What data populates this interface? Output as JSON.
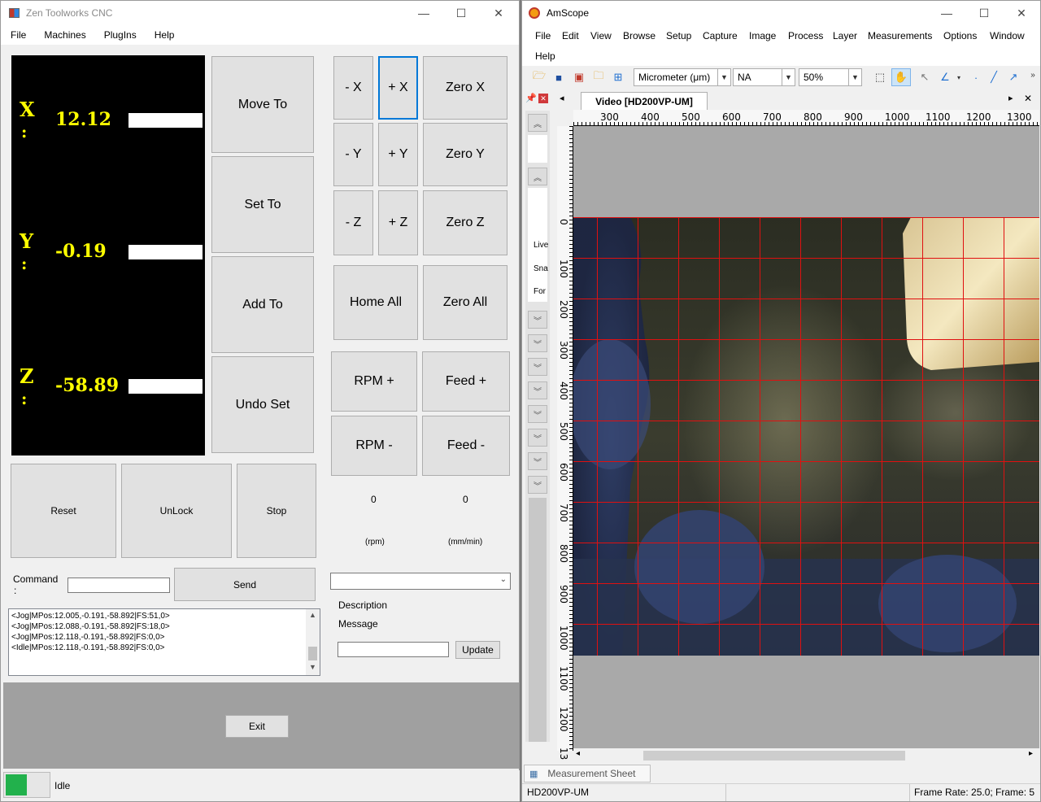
{
  "zen": {
    "title": "Zen Toolworks  CNC",
    "window_controls": {
      "minimize": "—",
      "maximize": "☐",
      "close": "✕"
    },
    "menu": [
      "File",
      "Machines",
      "PlugIns",
      "Help"
    ],
    "dro": {
      "x_label": "X",
      "x_colon": ":",
      "x_value": "12.12",
      "y_label": "Y",
      "y_colon": ":",
      "y_value": "-0.19",
      "z_label": "Z",
      "z_colon": ":",
      "z_value": "-58.89"
    },
    "buttons": {
      "move_to": "Move To",
      "set_to": "Set To",
      "add_to": "Add To",
      "undo_set": "Undo Set",
      "minus_x": "- X",
      "plus_x": "+ X",
      "zero_x": "Zero X",
      "minus_y": "- Y",
      "plus_y": "+ Y",
      "zero_y": "Zero Y",
      "minus_z": "- Z",
      "plus_z": "+ Z",
      "zero_z": "Zero Z",
      "home_all": "Home All",
      "zero_all": "Zero All",
      "rpm_plus": "RPM +",
      "feed_plus": "Feed +",
      "rpm_minus": "RPM -",
      "feed_minus": "Feed -",
      "reset": "Reset",
      "unlock": "UnLock",
      "stop": "Stop",
      "send": "Send",
      "update": "Update",
      "exit": "Exit"
    },
    "rpm_value": "0",
    "rpm_unit": "(rpm)",
    "feed_value": "0",
    "feed_unit": "(mm/min)",
    "command_label": "Command",
    "command_colon": ":",
    "command_value": "",
    "plugin_select_value": "",
    "description_label": "Description",
    "message_label": "Message",
    "message_value": "",
    "log_lines": [
      "<Jog|MPos:12.005,-0.191,-58.892|FS:51,0>",
      "<Jog|MPos:12.088,-0.191,-58.892|FS:18,0>",
      "<Jog|MPos:12.118,-0.191,-58.892|FS:0,0>",
      "<Idle|MPos:12.118,-0.191,-58.892|FS:0,0>"
    ],
    "status_text": "Idle",
    "status_color": "#22b14c"
  },
  "amscope": {
    "title": "AmScope",
    "window_controls": {
      "minimize": "—",
      "maximize": "☐",
      "close": "✕"
    },
    "menu": [
      "File",
      "Edit",
      "View",
      "Browse",
      "Setup",
      "Capture",
      "Image",
      "Process",
      "Layer",
      "Measurements",
      "Options",
      "Window",
      "Help"
    ],
    "unit_select": "Micrometer (μm)",
    "magnification_select": "NA",
    "zoom_select": "50%",
    "doc_tab": "Video [HD200VP-UM]",
    "side_labels": [
      "Live",
      "Sna",
      "For"
    ],
    "ruler_h": [
      "300",
      "400",
      "500",
      "600",
      "700",
      "800",
      "900",
      "1000",
      "1100",
      "1200",
      "1300"
    ],
    "ruler_v": [
      "0",
      "100",
      "200",
      "300",
      "400",
      "500",
      "600",
      "700",
      "800",
      "900",
      "1000",
      "1100",
      "1200",
      "13"
    ],
    "measurement_tab": "Measurement Sheet",
    "status_device": "HD200VP-UM",
    "status_frame": "Frame Rate: 25.0; Frame: 5",
    "grid_color": "#e01010"
  }
}
